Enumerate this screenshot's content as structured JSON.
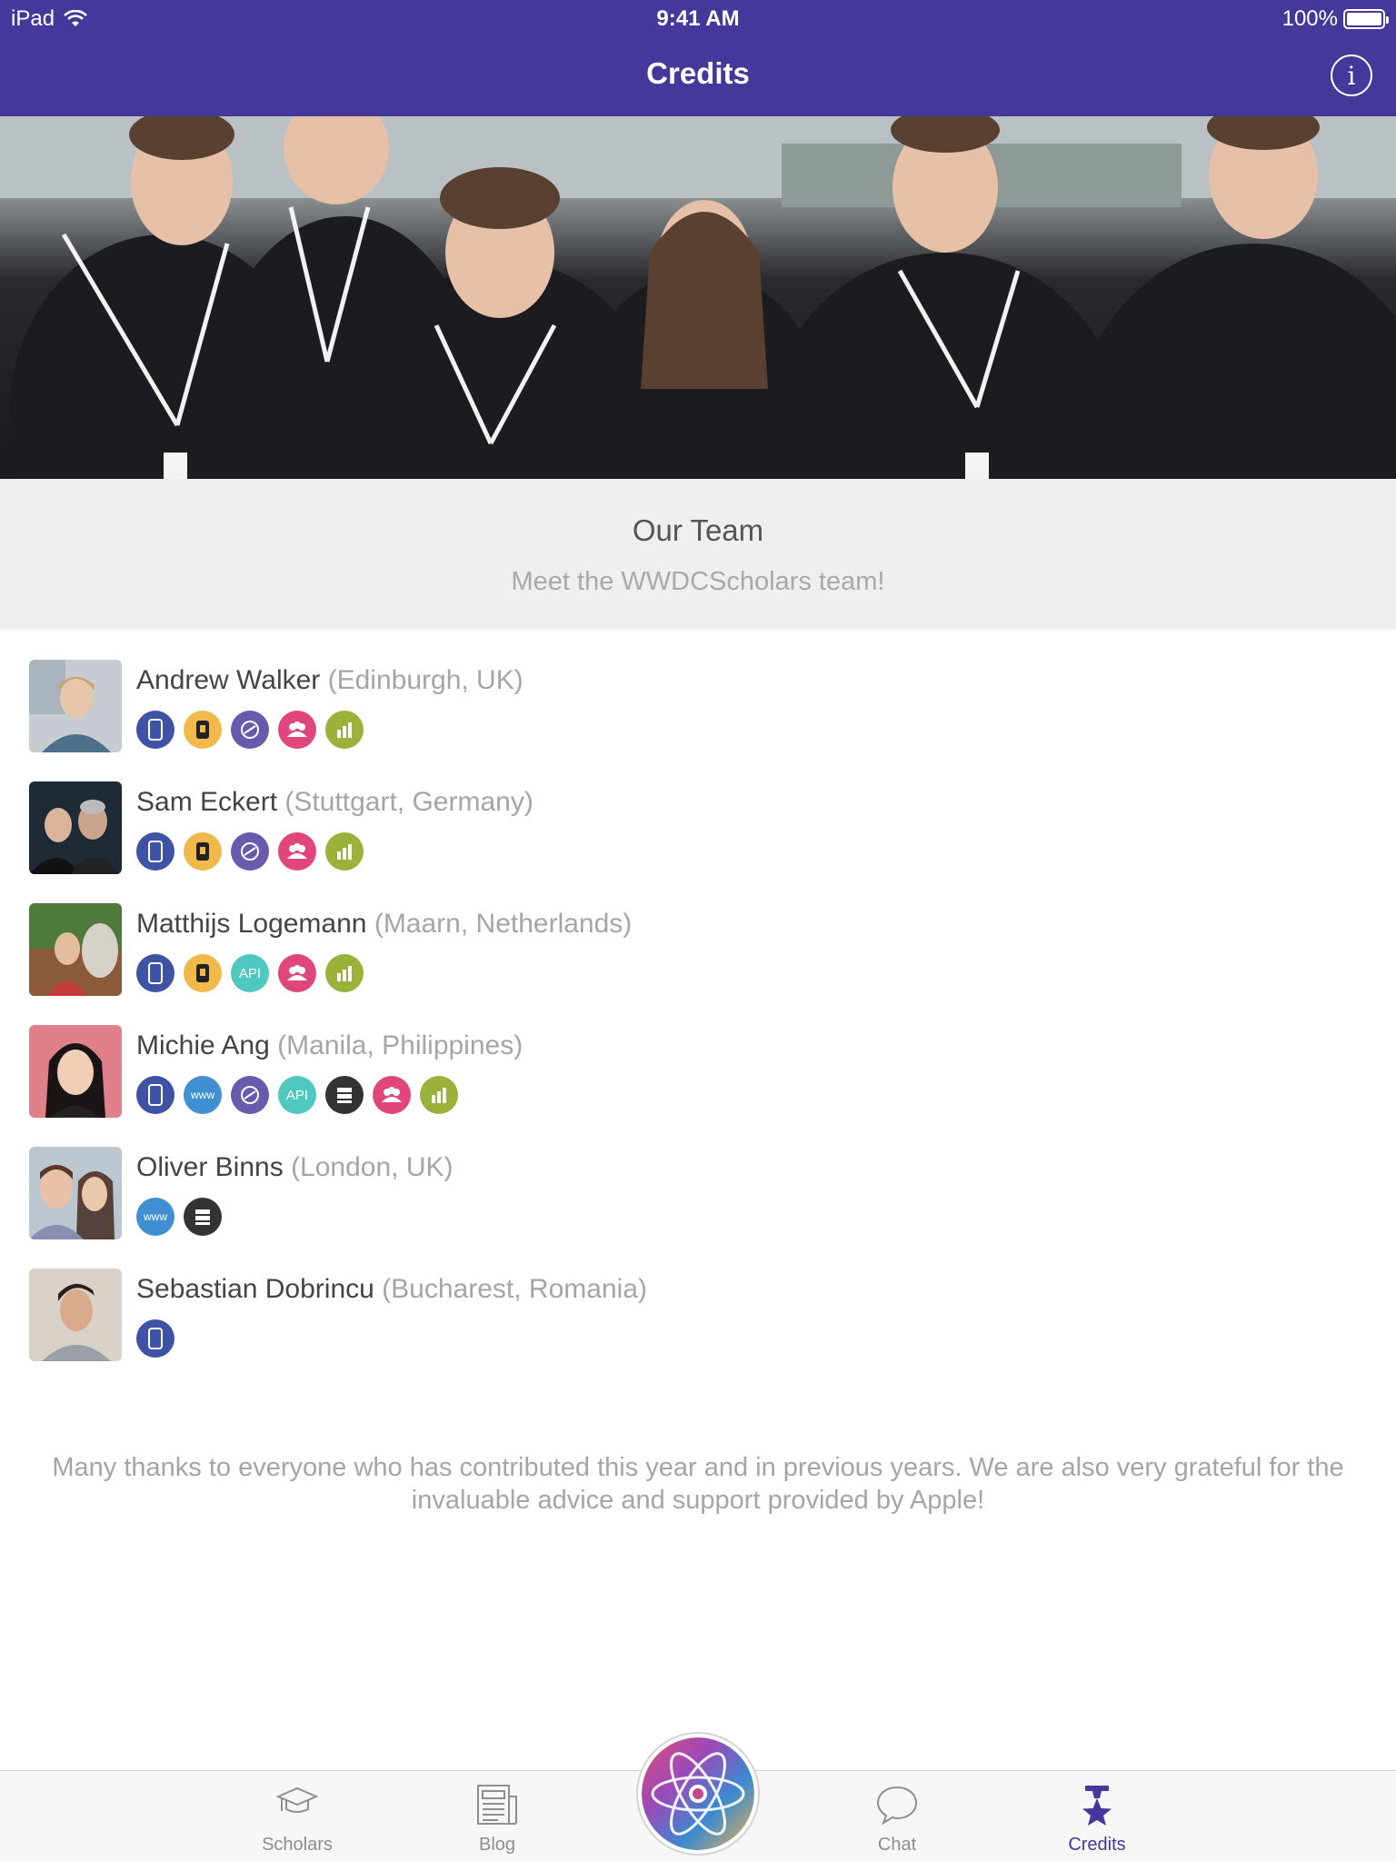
{
  "status_bar": {
    "device": "iPad",
    "time": "9:41 AM",
    "battery": "100%"
  },
  "nav": {
    "title": "Credits",
    "info_icon": "info-icon"
  },
  "team": {
    "title": "Our Team",
    "subtitle": "Meet the WWDCScholars team!"
  },
  "members": [
    {
      "name": "Andrew Walker",
      "location": "(Edinburgh, UK)",
      "badges": [
        "iphone",
        "watch",
        "mac",
        "team",
        "stats"
      ]
    },
    {
      "name": "Sam Eckert",
      "location": "(Stuttgart, Germany)",
      "badges": [
        "iphone",
        "watch",
        "mac",
        "team",
        "stats"
      ]
    },
    {
      "name": "Matthijs Logemann",
      "location": "(Maarn, Netherlands)",
      "badges": [
        "iphone",
        "watch",
        "api",
        "team",
        "stats"
      ]
    },
    {
      "name": "Michie Ang",
      "location": "(Manila, Philippines)",
      "badges": [
        "iphone",
        "www",
        "mac",
        "api",
        "server",
        "team",
        "stats"
      ]
    },
    {
      "name": "Oliver Binns",
      "location": "(London, UK)",
      "badges": [
        "www",
        "server"
      ]
    },
    {
      "name": "Sebastian Dobrincu",
      "location": "(Bucharest, Romania)",
      "badges": [
        "iphone"
      ]
    }
  ],
  "badge_text": {
    "www": "www",
    "api": "API"
  },
  "thanks": "Many thanks to everyone who has contributed this year and in previous years. We are also very grateful for the invaluable advice and support provided by Apple!",
  "tabs": [
    {
      "label": "Scholars",
      "icon": "graduation-cap-icon",
      "active": false
    },
    {
      "label": "Blog",
      "icon": "newspaper-icon",
      "active": false
    },
    {
      "label": "Chat",
      "icon": "speech-bubble-icon",
      "active": false
    },
    {
      "label": "Credits",
      "icon": "star-trophy-icon",
      "active": true
    }
  ],
  "center_button_icon": "atom-logo-icon",
  "colors": {
    "brand": "#44389a",
    "muted_text": "#a5a5a5"
  }
}
